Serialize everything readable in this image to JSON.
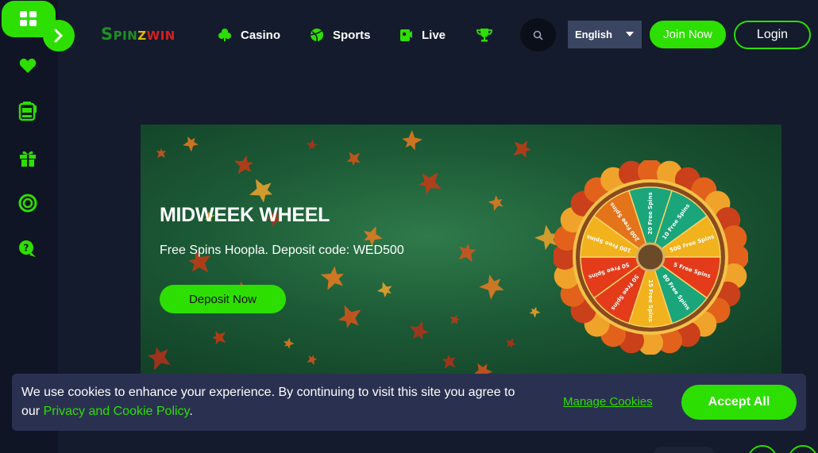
{
  "brand": {
    "logo_part1": "Spin",
    "logo_part2": "z",
    "logo_part3": "win",
    "accent_color": "#2ddf00"
  },
  "sidebar": {
    "menu_icon": "grid-icon",
    "expand_icon": "chevron-right-icon",
    "items": [
      {
        "icon": "heart-icon"
      },
      {
        "icon": "slot-machine-icon"
      },
      {
        "icon": "gift-icon"
      },
      {
        "icon": "lifebuoy-icon"
      },
      {
        "icon": "help-chat-icon"
      }
    ]
  },
  "header": {
    "nav": [
      {
        "label": "Casino",
        "icon": "clover-icon"
      },
      {
        "label": "Sports",
        "icon": "ball-icon"
      },
      {
        "label": "Live",
        "icon": "live-dealer-icon"
      },
      {
        "label": "",
        "icon": "trophy-icon"
      }
    ],
    "language": "English",
    "join_label": "Join Now",
    "login_label": "Login"
  },
  "banner": {
    "title": "MIDWEEK WHEEL",
    "subtitle": "Free Spins Hoopla. Deposit code: WED500",
    "cta_label": "Deposit Now",
    "wheel_segments": [
      "20 Free Spins",
      "10 Free Spins",
      "500 Free Spins",
      "5 Free Spins",
      "80 Free Spins",
      "15 Free Spins",
      "50 Free Spins",
      "50 Free Spins",
      "100 Free Spins",
      "200 Free Spins"
    ]
  },
  "cookie": {
    "text_before": "We use cookies to enhance your experience. By continuing to visit this site you agree to our ",
    "policy_link": "Privacy and Cookie Policy",
    "text_after": ".",
    "manage_label": "Manage Cookies",
    "accept_label": "Accept All"
  }
}
